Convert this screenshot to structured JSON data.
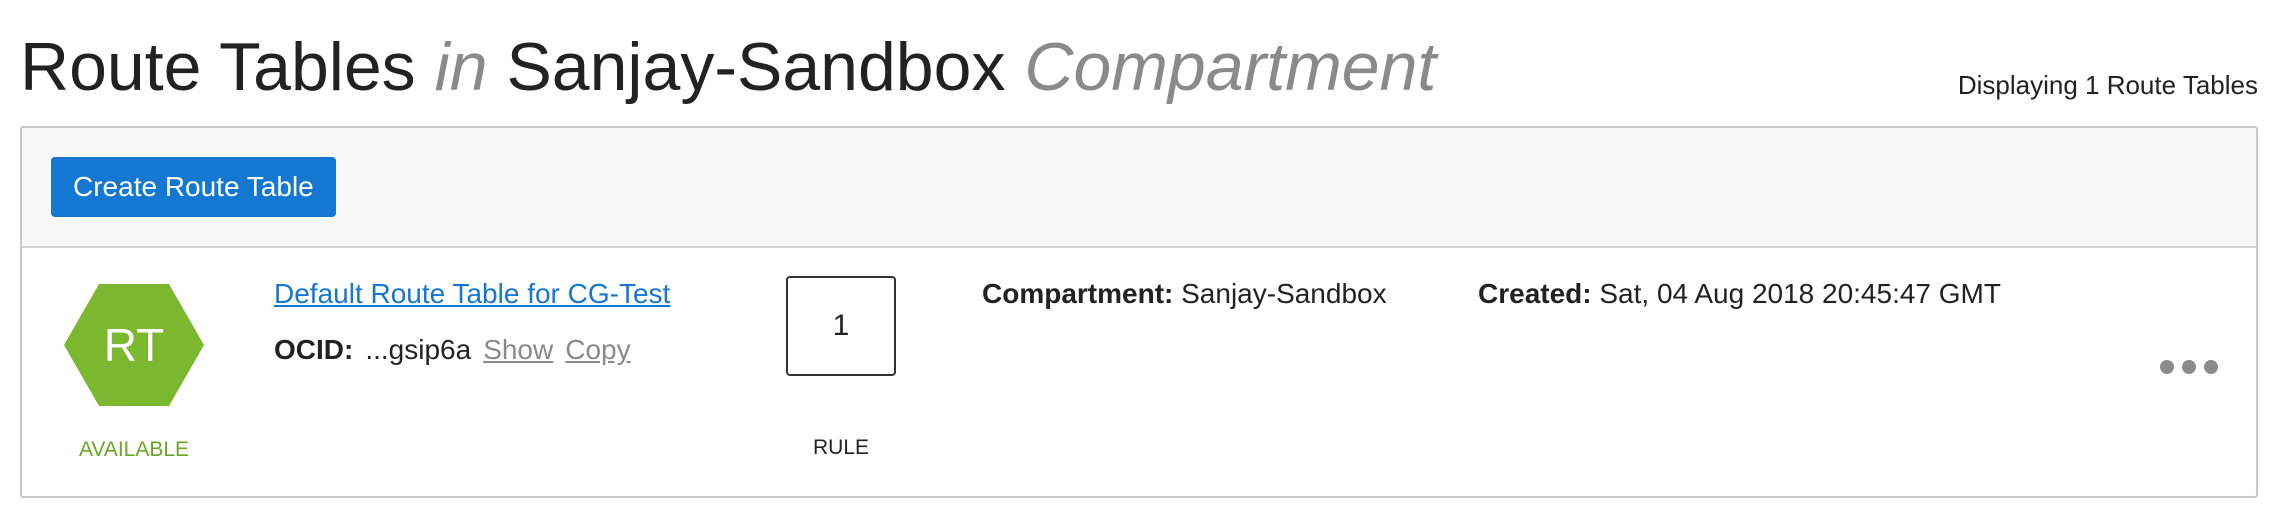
{
  "header": {
    "title_prefix": "Route Tables",
    "title_in": "in",
    "compartment_name": "Sanjay-Sandbox",
    "title_suffix": "Compartment",
    "count_text": "Displaying 1 Route Tables"
  },
  "toolbar": {
    "create_label": "Create Route Table"
  },
  "route_tables": [
    {
      "badge_text": "RT",
      "status": "AVAILABLE",
      "name": "Default Route Table for CG-Test",
      "ocid_label": "OCID:",
      "ocid_value": "...gsip6a",
      "show_label": "Show",
      "copy_label": "Copy",
      "rule_count": "1",
      "rule_label": "RULE",
      "compartment_label": "Compartment:",
      "compartment_value": "Sanjay-Sandbox",
      "created_label": "Created:",
      "created_value": "Sat, 04 Aug 2018 20:45:47 GMT"
    }
  ],
  "colors": {
    "accent": "#1477d2",
    "status_green": "#7cb82f"
  },
  "icons": {
    "badge": "hexagon-icon",
    "actions": "more-actions-icon"
  }
}
